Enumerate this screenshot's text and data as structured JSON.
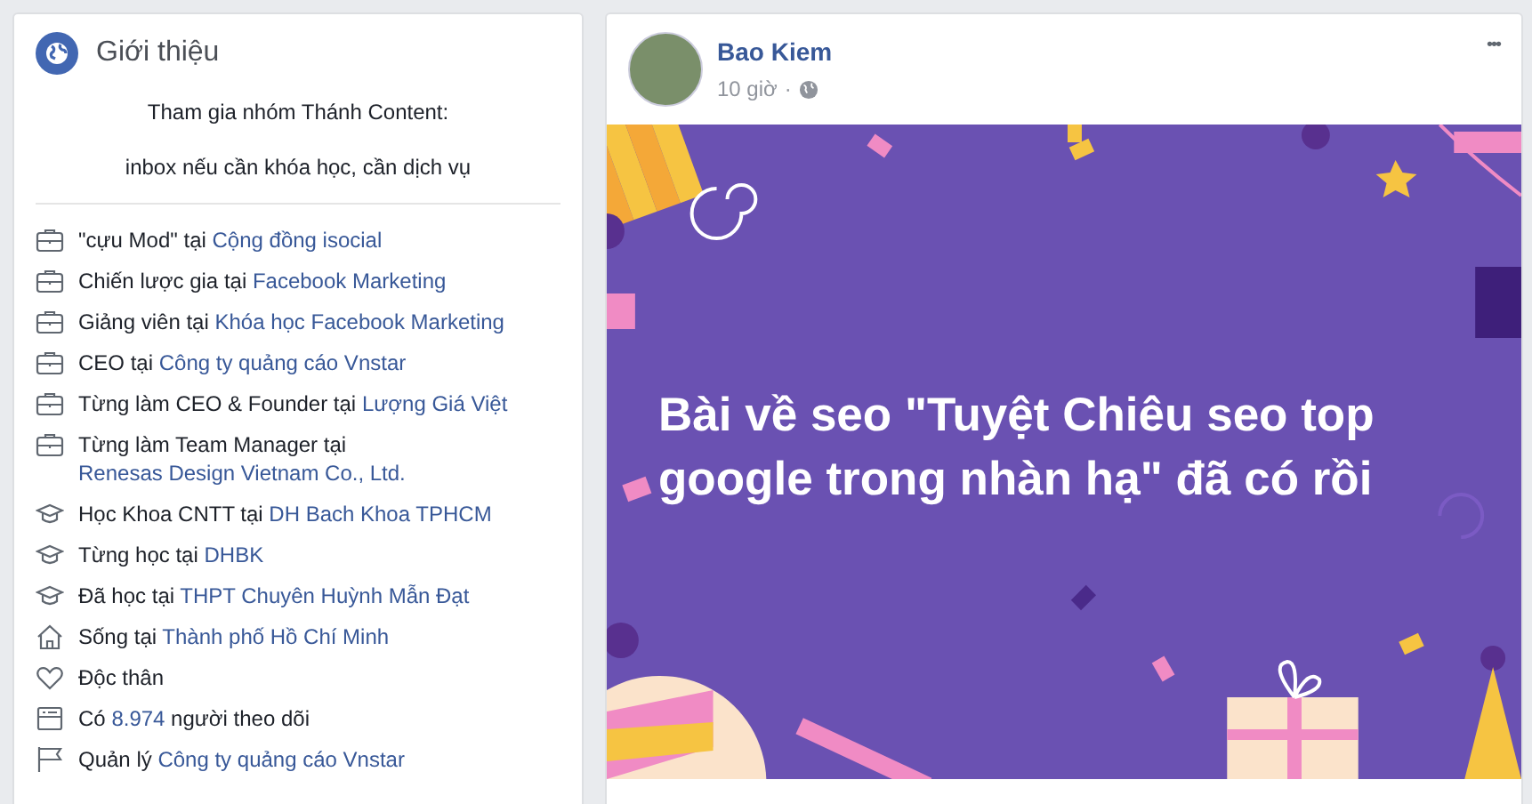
{
  "intro": {
    "title": "Giới thiệu",
    "bio": [
      "Tham gia nhóm Thánh Content:",
      "inbox nếu cần khóa học, cần dịch vụ"
    ],
    "items": [
      {
        "kind": "work",
        "prefix": "\"cựu Mod\" tại ",
        "link": "Cộng đồng isocial"
      },
      {
        "kind": "work",
        "prefix": "Chiến lược gia tại ",
        "link": "Facebook Marketing"
      },
      {
        "kind": "work",
        "prefix": "Giảng viên tại ",
        "link": "Khóa học Facebook Marketing"
      },
      {
        "kind": "work",
        "prefix": "CEO tại ",
        "link": "Công ty quảng cáo Vnstar"
      },
      {
        "kind": "work",
        "prefix": "Từng làm CEO & Founder tại ",
        "link": "Lượng Giá Việt"
      },
      {
        "kind": "work",
        "prefix": "Từng làm Team Manager tại ",
        "link": "Renesas Design Vietnam Co., Ltd."
      },
      {
        "kind": "education",
        "prefix": "Học Khoa CNTT tại ",
        "link": "DH Bach Khoa TPHCM"
      },
      {
        "kind": "education",
        "prefix": "Từng học tại ",
        "link": "DHBK"
      },
      {
        "kind": "education",
        "prefix": "Đã học tại ",
        "link": "THPT Chuyên Huỳnh Mẫn Đạt"
      },
      {
        "kind": "home",
        "prefix": "Sống tại ",
        "link": "Thành phố Hồ Chí Minh"
      },
      {
        "kind": "relationship",
        "prefix": "Độc thân"
      },
      {
        "kind": "followers",
        "prefix": "Có ",
        "link": "8.974",
        "suffix": " người theo dõi"
      },
      {
        "kind": "page",
        "prefix": "Quản lý ",
        "link": "Công ty quảng cáo Vnstar"
      }
    ]
  },
  "post": {
    "author": "Bao Kiem",
    "time": "10 giờ",
    "separator": "·",
    "more": "•••",
    "text": "Bài về seo \"Tuyệt Chiêu seo top google trong nhàn hạ\" đã có rồi"
  }
}
